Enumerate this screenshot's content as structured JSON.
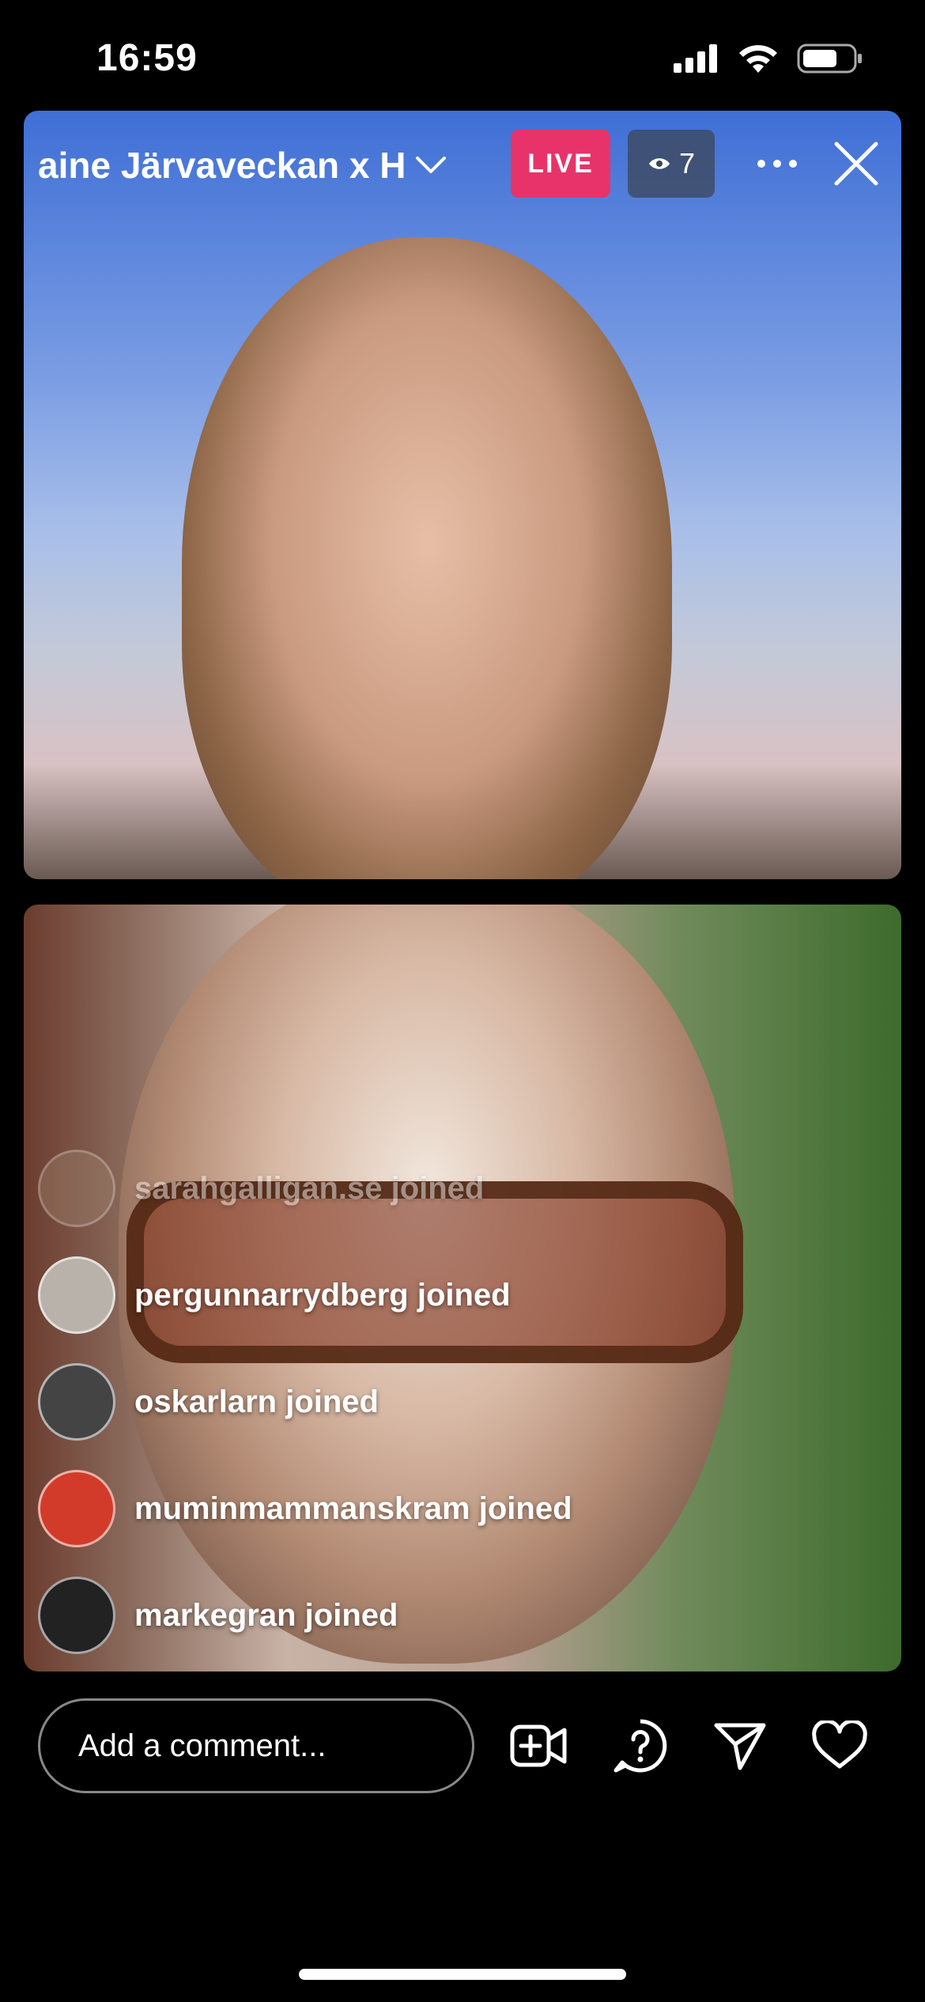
{
  "status_bar": {
    "time": "16:59"
  },
  "live": {
    "title": "aine  Järvaveckan x H",
    "live_label": "LIVE",
    "viewer_count": "7"
  },
  "joins": [
    {
      "text": "sarahgalligan.se joined",
      "avatar_color": "#9b7f6b"
    },
    {
      "text": "pergunnarrydberg joined",
      "avatar_color": "#b8b2aa"
    },
    {
      "text": "oskarlarn joined",
      "avatar_color": "#444444"
    },
    {
      "text": "muminmammanskram joined",
      "avatar_color": "#d23b2a"
    },
    {
      "text": "markegran joined",
      "avatar_color": "#222222"
    }
  ],
  "comment": {
    "placeholder": "Add a comment..."
  },
  "icons": [
    "video-add-icon",
    "question-icon",
    "send-icon",
    "heart-icon",
    "more-icon",
    "close-icon",
    "eye-icon",
    "chevron-down-icon"
  ]
}
